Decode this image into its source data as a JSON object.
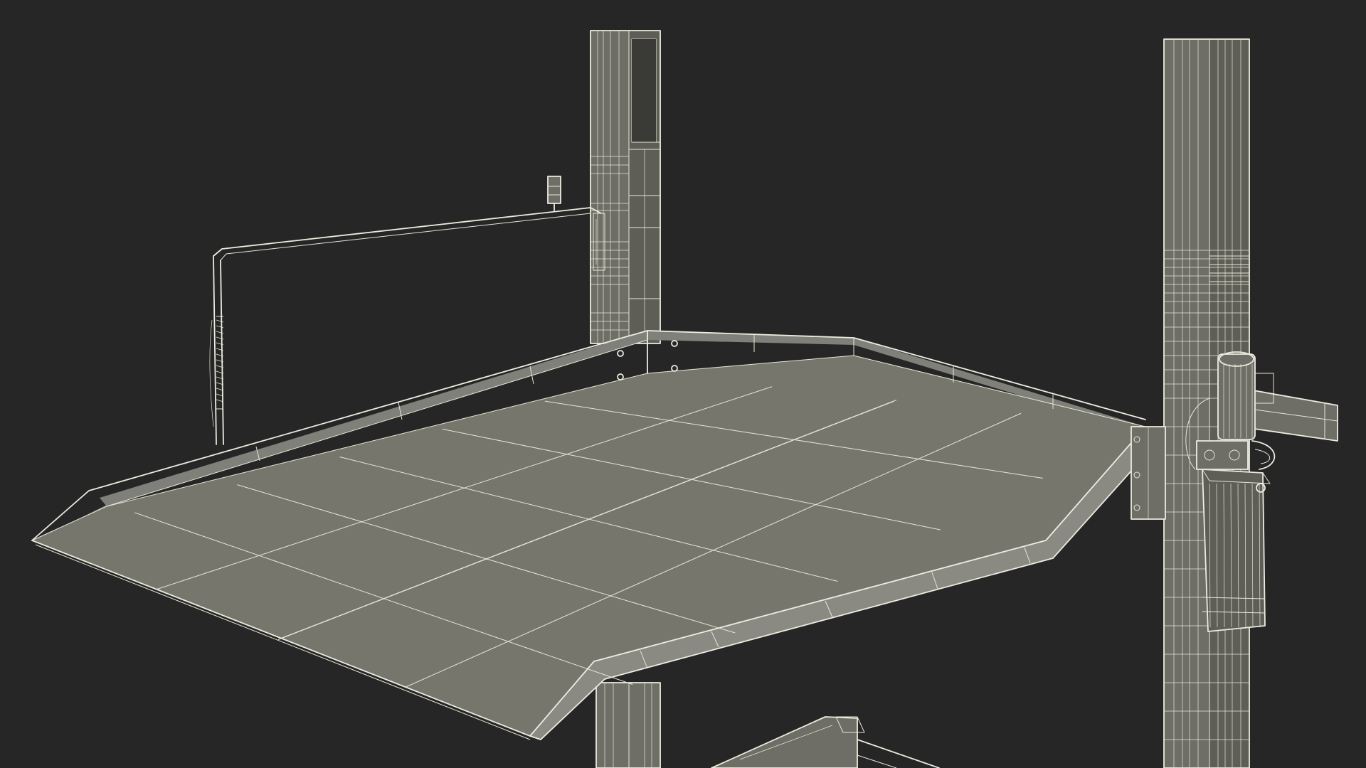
{
  "scene": {
    "subject": "two-post-parking-lift-wireframe-render",
    "background_color": "#262626",
    "surface_color": "#76766c",
    "surface_dark_color": "#5e5e56",
    "post_color": "#6e6e66",
    "wire_color": "#e6e6d6"
  }
}
